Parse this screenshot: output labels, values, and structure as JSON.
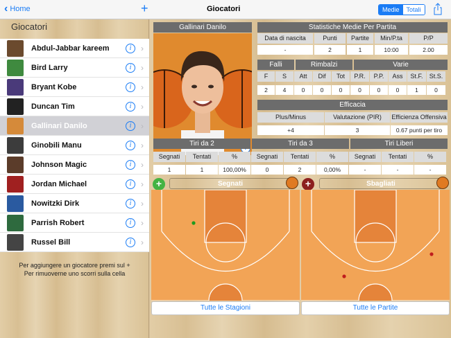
{
  "navbar": {
    "back_label": "Home",
    "add_icon": "plus-icon",
    "title": "Giocatori",
    "segment": [
      "Medie",
      "Totali"
    ],
    "segment_selected": "Medie",
    "share_icon": "share-icon"
  },
  "sidebar": {
    "title": "Giocatori",
    "players": [
      {
        "name": "Abdul-Jabbar kareem",
        "color": "#6b4a2e"
      },
      {
        "name": "Bird Larry",
        "color": "#3f8a3f"
      },
      {
        "name": "Bryant Kobe",
        "color": "#4a3a7a"
      },
      {
        "name": "Duncan Tim",
        "color": "#222222"
      },
      {
        "name": "Gallinari Danilo",
        "color": "#d58a3a"
      },
      {
        "name": "Ginobili Manu",
        "color": "#3c3c3c"
      },
      {
        "name": "Johnson Magic",
        "color": "#5b3c2a"
      },
      {
        "name": "Jordan Michael",
        "color": "#a02020"
      },
      {
        "name": "Nowitzki Dirk",
        "color": "#2a5aa0"
      },
      {
        "name": "Parrish Robert",
        "color": "#2e6a3e"
      },
      {
        "name": "Russel Bill",
        "color": "#444444"
      }
    ],
    "selected": 4,
    "note_line1": "Per aggiungere un giocatore premi sul +",
    "note_line2": "Per rimuoverne uno scorri sulla cella"
  },
  "player": {
    "name": "Gallinari Danilo"
  },
  "stats": {
    "title": "Statistiche Medie Per Partita",
    "row1_headers": [
      "Data di nascita",
      "Punti",
      "Partite",
      "Min/P.ta",
      "P/P"
    ],
    "row1_values": [
      "-",
      "2",
      "1",
      "10:00",
      "2.00"
    ],
    "group_headers": [
      "Falli",
      "Rimbalzi",
      "Varie"
    ],
    "row2_headers": [
      "F",
      "S",
      "Att",
      "Dif",
      "Tot",
      "P.R.",
      "P.P.",
      "Ass",
      "St.F.",
      "St.S."
    ],
    "row2_values": [
      "2",
      "4",
      "0",
      "0",
      "0",
      "0",
      "0",
      "0",
      "1",
      "0"
    ],
    "efficacy_title": "Efficacia",
    "eff_headers": [
      "Plus/Minus",
      "Valutazione (PIR)",
      "Efficienza Offensiva"
    ],
    "eff_values": [
      "+4",
      "3",
      "0.67 punti per tiro"
    ],
    "shot_groups": [
      "Tiri da 2",
      "Tiri da 3",
      "Tiri Liberi"
    ],
    "shot_headers": [
      "Segnati",
      "Tentati",
      "%",
      "Segnati",
      "Tentati",
      "%",
      "Segnati",
      "Tentati",
      "%"
    ],
    "shot_values": [
      "1",
      "1",
      "100,00%",
      "0",
      "2",
      "0,00%",
      "-",
      "-",
      "-"
    ]
  },
  "shots": {
    "made_label": "Segnati",
    "missed_label": "Sbagliati",
    "made_color": "#1f9a1f",
    "missed_color": "#c01d1d"
  },
  "buttons": {
    "seasons": "Tutte le Stagioni",
    "games": "Tutte le Partite"
  }
}
